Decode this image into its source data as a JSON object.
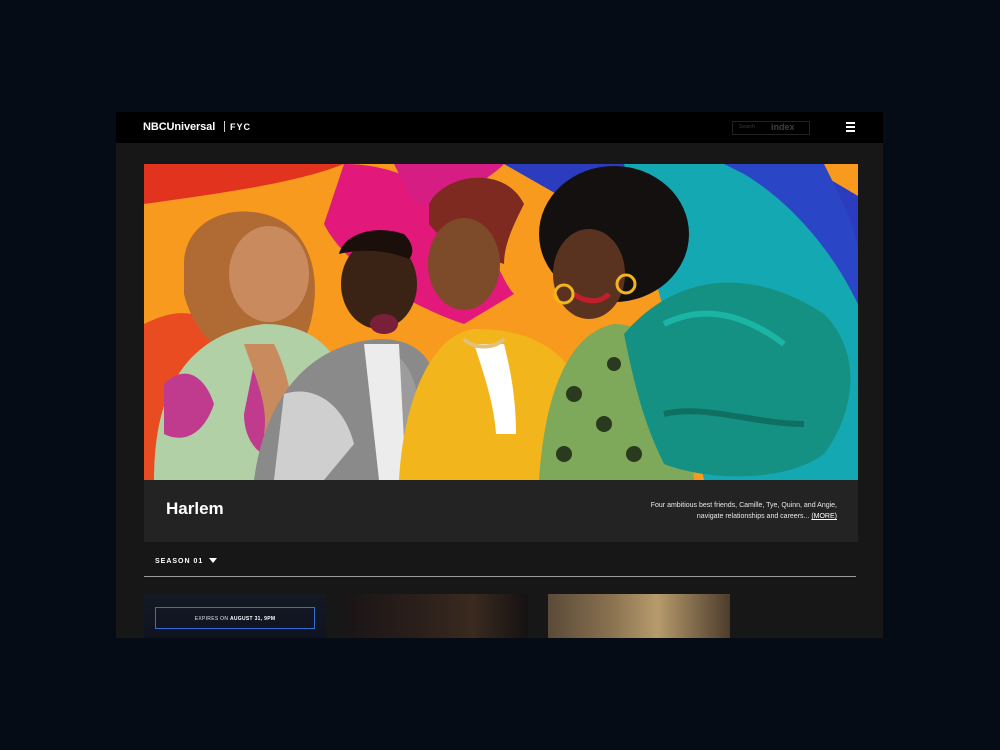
{
  "header": {
    "brand": "NBCUniversal",
    "sub_brand": "FYC",
    "search_placeholder": "Search",
    "search_button": "index",
    "menu_icon": "hamburger-menu-icon"
  },
  "show": {
    "title": "Harlem",
    "description": "Four ambitious best friends, Camille, Tye, Quinn, and Angie, navigate relationships and careers...",
    "more_label": "(MORE)"
  },
  "season": {
    "label": "SEASON 01",
    "caret_icon": "caret-down-icon"
  },
  "episodes": [
    {
      "expires_prefix": "EXPIRES ON",
      "expires_date": "AUGUST 31, 9PM"
    },
    {},
    {}
  ],
  "colors": {
    "page_bg": "#050c16",
    "app_bg": "#171717",
    "header_bg": "#000000",
    "title_bar_bg": "#232323",
    "accent_border": "#2f6fd6"
  }
}
